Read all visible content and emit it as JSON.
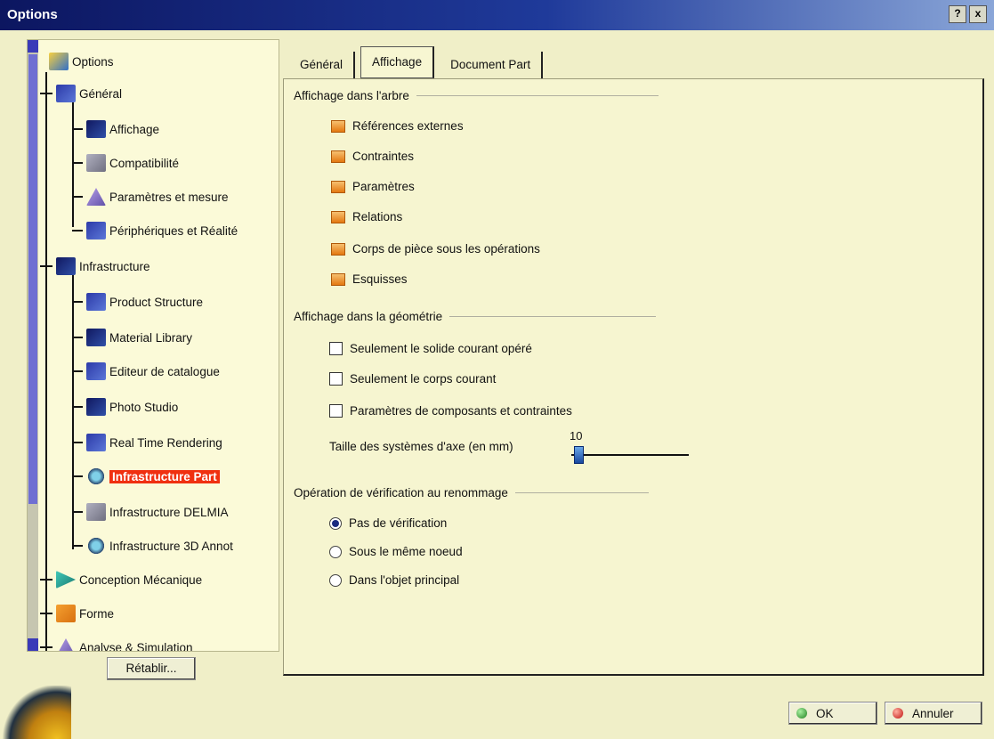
{
  "window": {
    "title": "Options",
    "help": "?",
    "close": "x"
  },
  "tree": {
    "root": "Options",
    "items": [
      "Général",
      "Affichage",
      "Compatibilité",
      "Paramètres et mesure",
      "Périphériques et Réalité",
      "Infrastructure",
      "Product Structure",
      "Material Library",
      "Editeur de catalogue",
      "Photo Studio",
      "Real Time Rendering",
      "Infrastructure Part",
      "Infrastructure DELMIA",
      "Infrastructure 3D Annot",
      "Conception Mécanique",
      "Forme",
      "Analyse & Simulation"
    ],
    "restore_label": "Rétablir..."
  },
  "tabs": [
    "Général",
    "Affichage",
    "Document Part"
  ],
  "sections": {
    "tree_display": {
      "title": "Affichage dans l'arbre",
      "items": [
        "Références externes",
        "Contraintes",
        "Paramètres",
        "Relations",
        "Corps de pièce sous les opérations",
        "Esquisses"
      ]
    },
    "geometry_display": {
      "title": "Affichage dans la géométrie",
      "items": [
        "Seulement le solide courant opéré",
        "Seulement le corps courant",
        "Paramètres de composants et contraintes"
      ],
      "slider_label": "Taille des systèmes d'axe (en mm)",
      "slider_value": "10"
    },
    "rename_check": {
      "title": "Opération de vérification au renommage",
      "options": [
        "Pas de vérification",
        "Sous le même noeud",
        "Dans l'objet principal"
      ],
      "selected": 0
    }
  },
  "buttons": {
    "ok": "OK",
    "cancel": "Annuler"
  },
  "colors": {
    "background": "#f0efc8",
    "highlight": "#f03010",
    "title_bar": "#0c1660"
  }
}
